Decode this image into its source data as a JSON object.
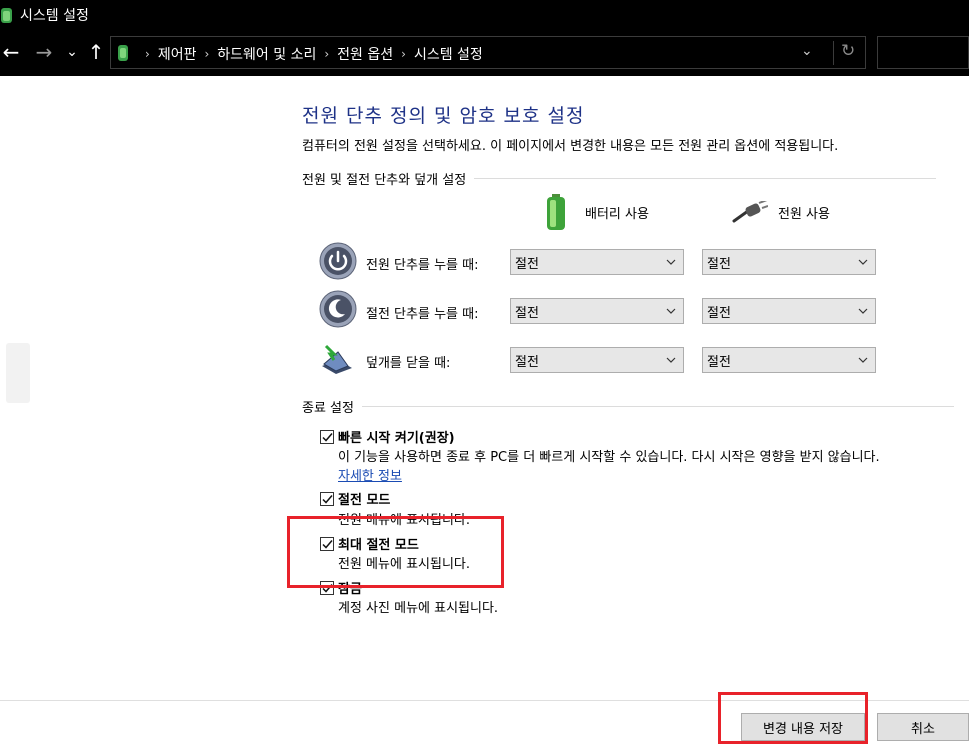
{
  "window": {
    "title": "시스템 설정"
  },
  "navigation": {
    "back_icon": "arrow-left-icon",
    "forward_icon": "arrow-right-icon",
    "up_icon": "arrow-up-icon",
    "breadcrumbs": [
      "제어판",
      "하드웨어 및 소리",
      "전원 옵션",
      "시스템 설정"
    ]
  },
  "page": {
    "title": "전원 단추 정의 및 암호 보호 설정",
    "description": "컴퓨터의 전원 설정을 선택하세요. 이 페이지에서 변경한 내용은 모든 전원 관리 옵션에 적용됩니다."
  },
  "power_buttons": {
    "section_title": "전원 및 절전 단추와 덮개 설정",
    "columns": {
      "battery": "배터리 사용",
      "plugged": "전원 사용"
    },
    "rows": [
      {
        "label": "전원 단추를 누를 때:",
        "battery": "절전",
        "plugged": "절전"
      },
      {
        "label": "절전 단추를 누를 때:",
        "battery": "절전",
        "plugged": "절전"
      },
      {
        "label": "덮개를 닫을 때:",
        "battery": "절전",
        "plugged": "절전"
      }
    ]
  },
  "shutdown": {
    "section_title": "종료 설정",
    "options": [
      {
        "title": "빠른 시작 켜기(권장)",
        "checked": true,
        "description": "이 기능을 사용하면 종료 후 PC를 더 빠르게 시작할 수 있습니다. 다시 시작은 영향을 받지 않습니다.",
        "link": "자세한 정보"
      },
      {
        "title": "절전 모드",
        "checked": true,
        "description": "전원 메뉴에 표시됩니다."
      },
      {
        "title": "최대 절전 모드",
        "checked": true,
        "description": "전원 메뉴에 표시됩니다."
      },
      {
        "title": "잠금",
        "checked": true,
        "description": "계정 사진 메뉴에 표시됩니다."
      }
    ]
  },
  "footer": {
    "save_label": "변경 내용 저장",
    "cancel_label": "취소"
  },
  "colors": {
    "title": "#1e3287",
    "link": "#1a4bb3",
    "annotation": "#e8222a"
  }
}
